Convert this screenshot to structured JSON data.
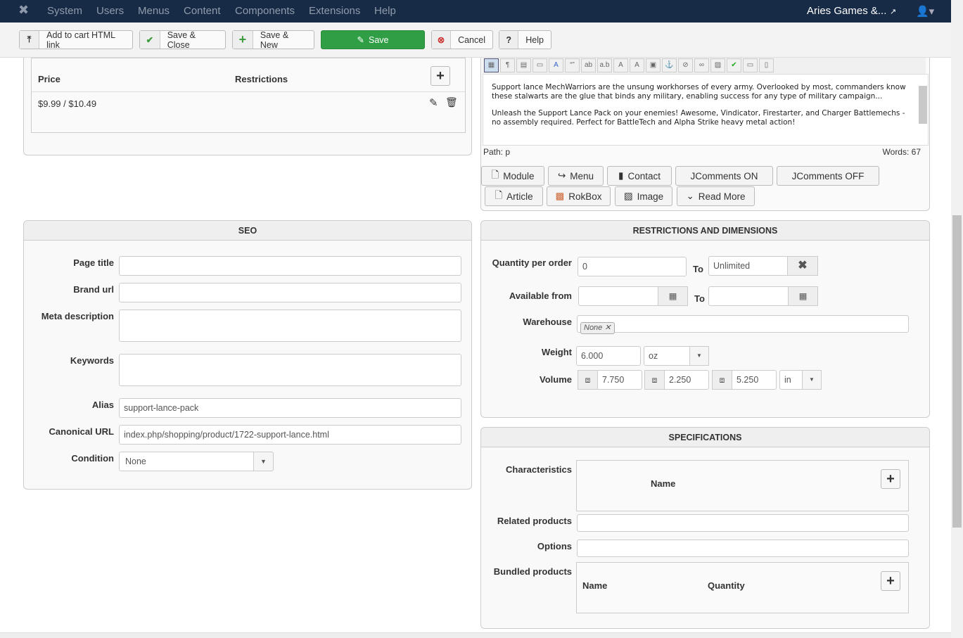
{
  "nav": {
    "items": [
      "System",
      "Users",
      "Menus",
      "Content",
      "Components",
      "Extensions",
      "Help"
    ],
    "site": "Aries Games &...",
    "logo": "joomla-logo"
  },
  "toolbar": {
    "add_cart": "Add to cart HTML link",
    "save_close": "Save & Close",
    "save_new": "Save & New",
    "save": "Save",
    "cancel": "Cancel",
    "help": "Help"
  },
  "price": {
    "header_price": "Price",
    "header_restrictions": "Restrictions",
    "value": "$9.99 / $10.49"
  },
  "editor": {
    "para1": "Support lance MechWarriors are the unsung workhorses of every army. Overlooked by most, commanders know these stalwarts are the glue that binds any military, enabling success for any type of military campaign...",
    "para2": "Unleash the Support Lance Pack on your enemies! Awesome, Vindicator, Firestarter, and Charger Battlemechs - no assembly required. Perfect for BattleTech and Alpha Strike heavy metal action!",
    "path": "Path:  p",
    "words": "Words: 67",
    "buttons": {
      "module": "Module",
      "menu": "Menu",
      "contact": "Contact",
      "jon": "JComments ON",
      "joff": "JComments OFF",
      "article": "Article",
      "rokbox": "RokBox",
      "image": "Image",
      "readmore": "Read More"
    }
  },
  "seo": {
    "title": "SEO",
    "page_title": "Page title",
    "brand_url": "Brand url",
    "meta": "Meta description",
    "keywords": "Keywords",
    "alias_label": "Alias",
    "alias": "support-lance-pack",
    "canonical_label": "Canonical URL",
    "canonical": "index.php/shopping/product/1722-support-lance.html",
    "condition_label": "Condition",
    "condition": "None"
  },
  "restr": {
    "title": "RESTRICTIONS AND DIMENSIONS",
    "qty_label": "Quantity per order",
    "qty": "0",
    "to": "To",
    "qty_to": "Unlimited",
    "avail_label": "Available from",
    "warehouse_label": "Warehouse",
    "warehouse_tag": "None",
    "weight_label": "Weight",
    "weight": "6.000",
    "weight_unit": "oz",
    "volume_label": "Volume",
    "v1": "7.750",
    "v2": "2.250",
    "v3": "5.250",
    "volume_unit": "in"
  },
  "spec": {
    "title": "SPECIFICATIONS",
    "char_label": "Characteristics",
    "name": "Name",
    "related": "Related products",
    "options": "Options",
    "bundled": "Bundled products",
    "quantity": "Quantity"
  }
}
